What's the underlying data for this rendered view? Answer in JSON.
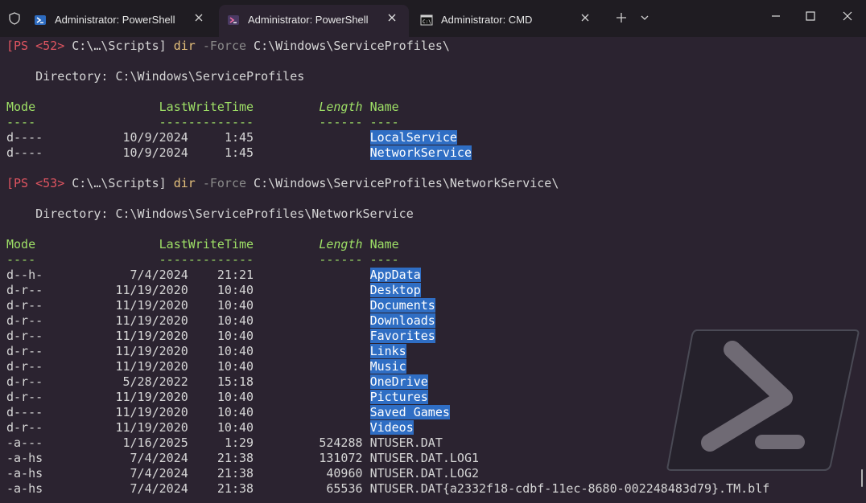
{
  "tabs": [
    {
      "label": "Administrator: PowerShell",
      "icon": "powershell-icon",
      "active": false
    },
    {
      "label": "Administrator: PowerShell",
      "icon": "powershell-icon",
      "active": true
    },
    {
      "label": "Administrator: CMD",
      "icon": "cmd-icon",
      "active": false
    }
  ],
  "colors": {
    "background": "#2b2330",
    "titlebar": "#1f1c22",
    "prompt": "#e05561",
    "command": "#e5c07b",
    "header": "#9ee066",
    "highlight": "#2f6ec4"
  },
  "prompts": [
    {
      "open": "[PS <52>",
      "path": " C:\\…\\Scripts]",
      "cmd": " dir",
      "flag": " -Force",
      "arg": " C:\\Windows\\ServiceProfiles\\"
    },
    {
      "open": "[PS <53>",
      "path": " C:\\…\\Scripts]",
      "cmd": " dir",
      "flag": " -Force",
      "arg": " C:\\Windows\\ServiceProfiles\\NetworkService\\"
    }
  ],
  "directories": [
    "    Directory: C:\\Windows\\ServiceProfiles",
    "    Directory: C:\\Windows\\ServiceProfiles\\NetworkService"
  ],
  "table_headers": {
    "mode": "Mode",
    "lastwritetime": "LastWriteTime",
    "length": "Length",
    "name": "Name",
    "underline_mode": "----",
    "underline_lwt": "-------------",
    "underline_length": "------",
    "underline_name": "----"
  },
  "listing1": [
    {
      "mode": "d----",
      "date": "10/9/2024",
      "time": "1:45",
      "length": "",
      "name": "LocalService",
      "dir": true
    },
    {
      "mode": "d----",
      "date": "10/9/2024",
      "time": "1:45",
      "length": "",
      "name": "NetworkService",
      "dir": true
    }
  ],
  "listing2": [
    {
      "mode": "d--h-",
      "date": "7/4/2024",
      "time": "21:21",
      "length": "",
      "name": "AppData",
      "dir": true
    },
    {
      "mode": "d-r--",
      "date": "11/19/2020",
      "time": "10:40",
      "length": "",
      "name": "Desktop",
      "dir": true
    },
    {
      "mode": "d-r--",
      "date": "11/19/2020",
      "time": "10:40",
      "length": "",
      "name": "Documents",
      "dir": true
    },
    {
      "mode": "d-r--",
      "date": "11/19/2020",
      "time": "10:40",
      "length": "",
      "name": "Downloads",
      "dir": true
    },
    {
      "mode": "d-r--",
      "date": "11/19/2020",
      "time": "10:40",
      "length": "",
      "name": "Favorites",
      "dir": true
    },
    {
      "mode": "d-r--",
      "date": "11/19/2020",
      "time": "10:40",
      "length": "",
      "name": "Links",
      "dir": true
    },
    {
      "mode": "d-r--",
      "date": "11/19/2020",
      "time": "10:40",
      "length": "",
      "name": "Music",
      "dir": true
    },
    {
      "mode": "d-r--",
      "date": "5/28/2022",
      "time": "15:18",
      "length": "",
      "name": "OneDrive",
      "dir": true
    },
    {
      "mode": "d-r--",
      "date": "11/19/2020",
      "time": "10:40",
      "length": "",
      "name": "Pictures",
      "dir": true
    },
    {
      "mode": "d----",
      "date": "11/19/2020",
      "time": "10:40",
      "length": "",
      "name": "Saved Games",
      "dir": true
    },
    {
      "mode": "d-r--",
      "date": "11/19/2020",
      "time": "10:40",
      "length": "",
      "name": "Videos",
      "dir": true
    },
    {
      "mode": "-a---",
      "date": "1/16/2025",
      "time": "1:29",
      "length": "524288",
      "name": "NTUSER.DAT",
      "dir": false
    },
    {
      "mode": "-a-hs",
      "date": "7/4/2024",
      "time": "21:38",
      "length": "131072",
      "name": "NTUSER.DAT.LOG1",
      "dir": false
    },
    {
      "mode": "-a-hs",
      "date": "7/4/2024",
      "time": "21:38",
      "length": "40960",
      "name": "NTUSER.DAT.LOG2",
      "dir": false
    },
    {
      "mode": "-a-hs",
      "date": "7/4/2024",
      "time": "21:38",
      "length": "65536",
      "name": "NTUSER.DAT{a2332f18-cdbf-11ec-8680-002248483d79}.TM.blf",
      "dir": false
    }
  ]
}
